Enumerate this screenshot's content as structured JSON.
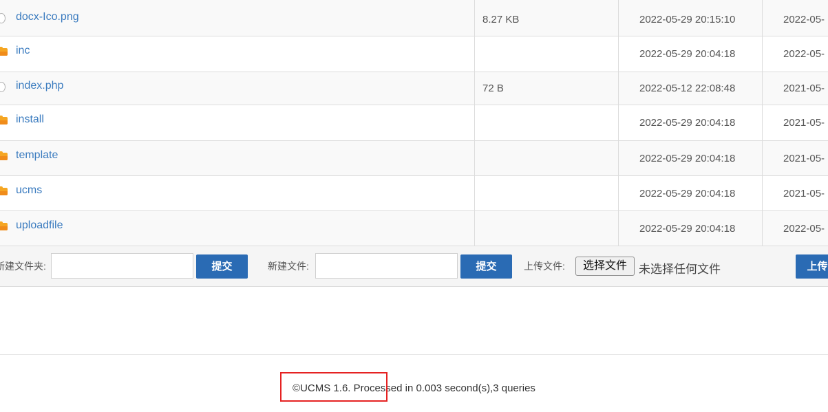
{
  "files": [
    {
      "name": "docx-Ico.png",
      "type": "file",
      "size": "8.27 KB",
      "modified": "2022-05-29 20:15:10",
      "created": "2022-05-"
    },
    {
      "name": "inc",
      "type": "folder",
      "size": "",
      "modified": "2022-05-29 20:04:18",
      "created": "2022-05-"
    },
    {
      "name": "index.php",
      "type": "file",
      "size": "72 B",
      "modified": "2022-05-12 22:08:48",
      "created": "2021-05-"
    },
    {
      "name": "install",
      "type": "folder",
      "size": "",
      "modified": "2022-05-29 20:04:18",
      "created": "2021-05-"
    },
    {
      "name": "template",
      "type": "folder",
      "size": "",
      "modified": "2022-05-29 20:04:18",
      "created": "2021-05-"
    },
    {
      "name": "ucms",
      "type": "folder",
      "size": "",
      "modified": "2022-05-29 20:04:18",
      "created": "2021-05-"
    },
    {
      "name": "uploadfile",
      "type": "folder",
      "size": "",
      "modified": "2022-05-29 20:04:18",
      "created": "2022-05-"
    }
  ],
  "actions": {
    "new_folder_label": "新建文件夹:",
    "new_folder_value": "",
    "new_folder_submit": "提交",
    "new_file_label": "新建文件:",
    "new_file_value": "",
    "new_file_submit": "提交",
    "upload_label": "上传文件:",
    "choose_file": "选择文件",
    "no_file_chosen": "未选择任何文件",
    "upload_submit": "上传"
  },
  "footer": {
    "text": "©UCMS 1.6. Processed in 0.003 second(s),3 queries"
  },
  "colors": {
    "link": "#3a7bbf",
    "button": "#2a6bb4",
    "folder": "#f5a623",
    "highlight": "#e52222"
  }
}
